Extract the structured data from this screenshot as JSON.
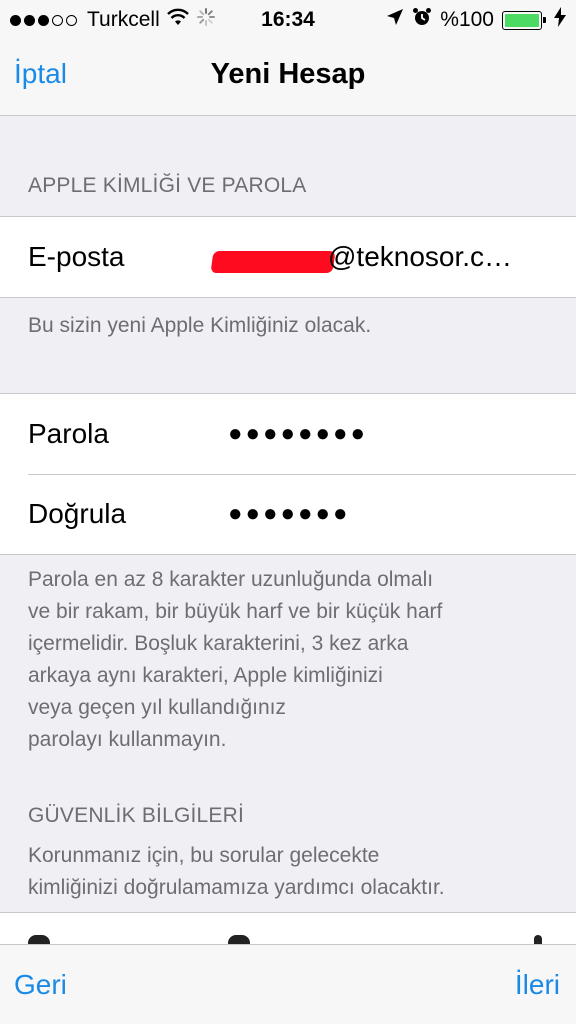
{
  "status_bar": {
    "carrier": "Turkcell",
    "time": "16:34",
    "battery": "%100",
    "signal_bars_filled": 3,
    "signal_bars_total": 5,
    "battery_level": 1.0
  },
  "nav": {
    "cancel_label": "İptal",
    "title": "Yeni Hesap"
  },
  "apple_id_section": {
    "header": "APPLE KİMLİĞİ VE PAROLA",
    "email_label": "E-posta",
    "email_value": "@teknosor.c…",
    "footer": "Bu sizin yeni Apple Kimliğiniz olacak."
  },
  "password_section": {
    "password_label": "Parola",
    "password_value": "●●●●●●●●",
    "verify_label": "Doğrula",
    "verify_value": "●●●●●●●",
    "footer_lines": [
      "Parola en az 8 karakter uzunluğunda olmalı",
      "ve bir rakam, bir büyük harf ve bir küçük harf",
      "içermelidir. Boşluk karakterini, 3 kez arka",
      "arkaya aynı karakteri, Apple kimliğinizi",
      "veya geçen yıl kullandığınız",
      "parolayı kullanmayın."
    ]
  },
  "security_section": {
    "header": "GÜVENLİK BİLGİLERİ",
    "description_lines": [
      "Korunmanız için, bu sorular gelecekte",
      "kimliğinizi doğrulamamıza yardımcı olacaktır."
    ]
  },
  "toolbar": {
    "back_label": "Geri",
    "next_label": "İleri"
  },
  "colors": {
    "accent": "#1b8ae6",
    "battery": "#4cd964",
    "redaction": "#ff0b1f",
    "background": "#efeff4"
  },
  "icons": [
    "signal-dots-icon",
    "wifi-icon",
    "activity-spinner-icon",
    "location-arrow-icon",
    "alarm-clock-icon",
    "battery-icon",
    "charging-bolt-icon"
  ]
}
